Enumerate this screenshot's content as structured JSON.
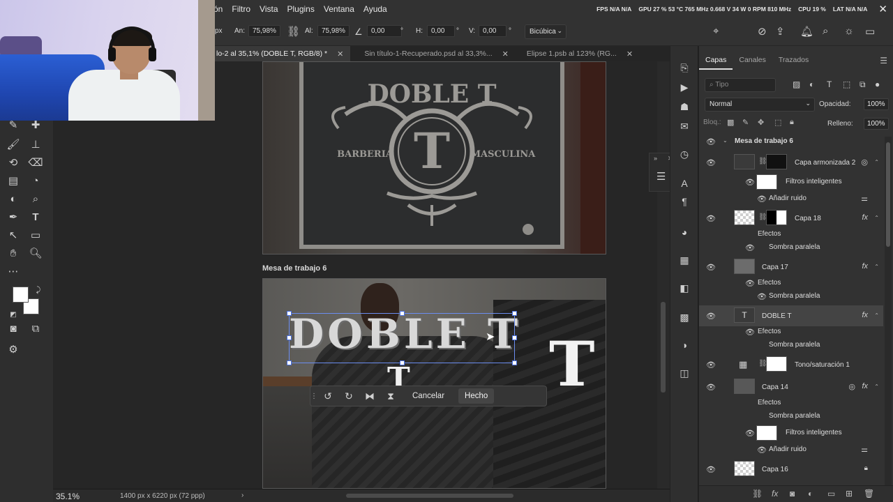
{
  "menubar": {
    "items": [
      "ón",
      "Filtro",
      "Vista",
      "Plugins",
      "Ventana",
      "Ayuda"
    ],
    "stats": {
      "fps": "FPS N/A N/A",
      "gpu": "GPU 27 % 53 °C 765 MHz 0.668 V 34 W 0 RPM 810 MHz",
      "cpu": "CPU 19 %",
      "lat": "LAT N/A N/A"
    }
  },
  "options": {
    "px": "px",
    "width_label": "An:",
    "width_value": "75,98%",
    "height_label": "Al:",
    "height_value": "75,98%",
    "angle_value": "0,00",
    "deg_unit": "°",
    "h_label": "H:",
    "h_value": "0,00",
    "v_label": "V:",
    "v_value": "0,00",
    "interpolation": "Bicúbica"
  },
  "tabs": [
    {
      "label": "lo-2 al 35,1% (DOBLE T, RGB/8) *",
      "active": true
    },
    {
      "label": "Sin título-1-Recuperado.psd al 33,3%...",
      "active": false
    },
    {
      "label": "Elipse 1.psb al 123% (RG...",
      "active": false
    }
  ],
  "canvas": {
    "artboard_label": "Mesa de trabajo 6",
    "doble_text": "DOBLE T",
    "logo_text": {
      "brand": "DOBLE T",
      "left": "BARBERIA",
      "right": "MASCULINA",
      "monogram": "T"
    },
    "context_bar": {
      "cancel": "Cancelar",
      "done": "Hecho"
    }
  },
  "statusbar": {
    "zoom": "35.1%",
    "dims": "1400 px x 6220 px (72 ppp)"
  },
  "layers_panel": {
    "tabs": [
      "Capas",
      "Canales",
      "Trazados"
    ],
    "search_placeholder": "Tipo",
    "blend_mode": "Normal",
    "opacity_label": "Opacidad:",
    "opacity_value": "100%",
    "lock_label": "Bloq.:",
    "fill_label": "Relleno:",
    "fill_value": "100%",
    "group_name": "Mesa de trabajo 6",
    "rows": [
      {
        "name": "Capa armonizada 2"
      },
      {
        "name": "Filtros inteligentes"
      },
      {
        "name": "Añadir ruido"
      },
      {
        "name": "Capa 18"
      },
      {
        "name": "Efectos"
      },
      {
        "name": "Sombra paralela"
      },
      {
        "name": "Capa 17"
      },
      {
        "name": "Efectos"
      },
      {
        "name": "Sombra paralela"
      },
      {
        "name": "DOBLE T"
      },
      {
        "name": "Efectos"
      },
      {
        "name": "Sombra paralela"
      },
      {
        "name": "Tono/saturación 1"
      },
      {
        "name": "Capa 14"
      },
      {
        "name": "Efectos"
      },
      {
        "name": "Sombra paralela"
      },
      {
        "name": "Filtros inteligentes"
      },
      {
        "name": "Añadir ruido"
      },
      {
        "name": "Capa 16"
      }
    ],
    "fx_label": "fx"
  }
}
